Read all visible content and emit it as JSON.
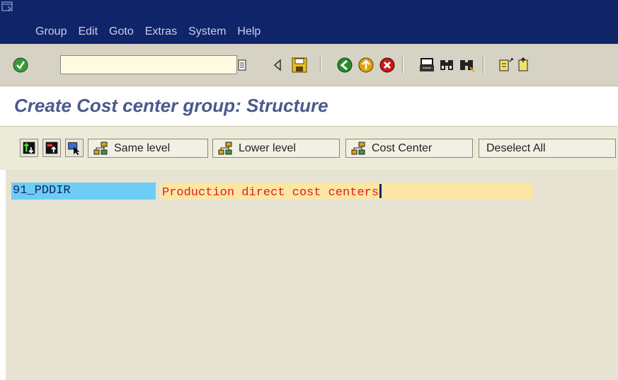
{
  "menu": {
    "items": [
      "Group",
      "Edit",
      "Goto",
      "Extras",
      "System",
      "Help"
    ]
  },
  "toolbar": {
    "command_field_value": "",
    "icons": [
      "enter-icon",
      "save-icon",
      "back-icon",
      "exit-icon",
      "cancel-icon",
      "print-icon",
      "find-icon",
      "find-next-icon",
      "first-page-icon",
      "previous-page-icon"
    ]
  },
  "page": {
    "title": "Create Cost center group: Structure"
  },
  "app_toolbar": {
    "same_level_label": "Same level",
    "lower_level_label": "Lower level",
    "cost_center_label": "Cost Center",
    "deselect_all_label": "Deselect All"
  },
  "tree": {
    "node_id": "91_PDDIR",
    "node_description": "Production direct cost centers"
  },
  "colors": {
    "menubar": "#10246a",
    "title": "#4a5a8c",
    "node_id_bg": "#6ecdf5",
    "node_desc_bg": "#fbe6a6",
    "node_desc_text": "#e02010"
  }
}
